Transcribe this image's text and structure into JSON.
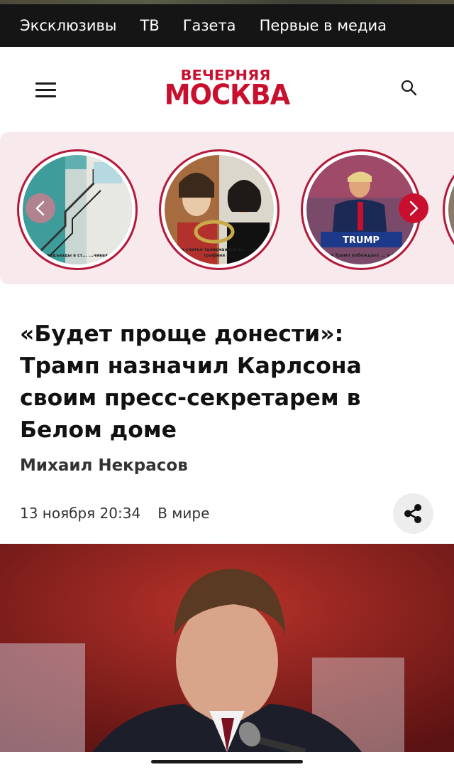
{
  "top_nav": {
    "items": [
      "Эксклюзивы",
      "ТВ",
      "Газета",
      "Первые в медиа"
    ]
  },
  "header": {
    "logo_line1": "ВЕЧЕРНЯЯ",
    "logo_line2": "МОСКВА",
    "menu_icon": "hamburger-menu-icon",
    "search_icon": "search-icon"
  },
  "stories": {
    "items": [
      {
        "caption": "...в СССР подъезды в ст... ...чивая краска..."
      },
      {
        "caption": "...не считал талисманами д... ...чила графиня Р..."
      },
      {
        "caption": "...чем Трамп побеждает ... в США"
      }
    ],
    "prev_icon": "chevron-left-icon",
    "next_icon": "chevron-right-icon"
  },
  "article": {
    "title": "«Будет проще донести»: Трамп назначил Карлсона своим пресс-секретарем в Белом доме",
    "author": "Михаил Некрасов",
    "date": "13 ноября 20:34",
    "category": "В мире",
    "share_icon": "share-icon"
  },
  "colors": {
    "brand": "#c8102e",
    "topnav_bg": "#151515",
    "stories_bg": "#f8e9ec"
  }
}
